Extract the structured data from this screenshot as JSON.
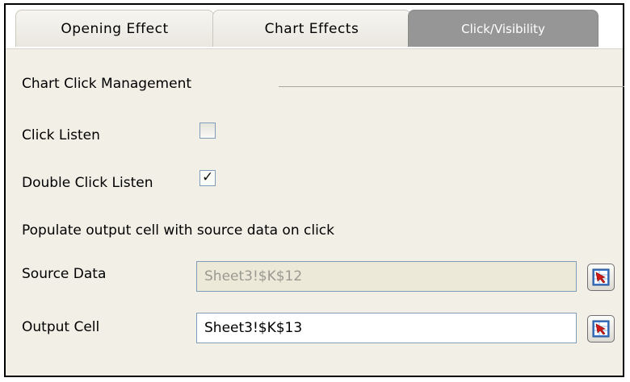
{
  "tabs": [
    {
      "label": "Opening Effect"
    },
    {
      "label": "Chart Effects"
    },
    {
      "label": "Click/Visibility"
    }
  ],
  "section_title": "Chart Click Management",
  "click_listen": {
    "label": "Click Listen",
    "checked": false
  },
  "double_click_listen": {
    "label": "Double Click Listen",
    "checked": true,
    "mark": "✓"
  },
  "populate_label": "Populate output cell with source data on click",
  "source_data": {
    "label": "Source Data",
    "value": "Sheet3!$K$12",
    "enabled": false
  },
  "output_cell": {
    "label": "Output Cell",
    "value": "Sheet3!$K$13",
    "enabled": true
  },
  "range_button_icon": "cell-range-picker-icon",
  "colors": {
    "active_tab": "#969696",
    "panel": "#f1efe6",
    "field_border": "#7f9db9",
    "disabled_field": "#ece9d8"
  }
}
